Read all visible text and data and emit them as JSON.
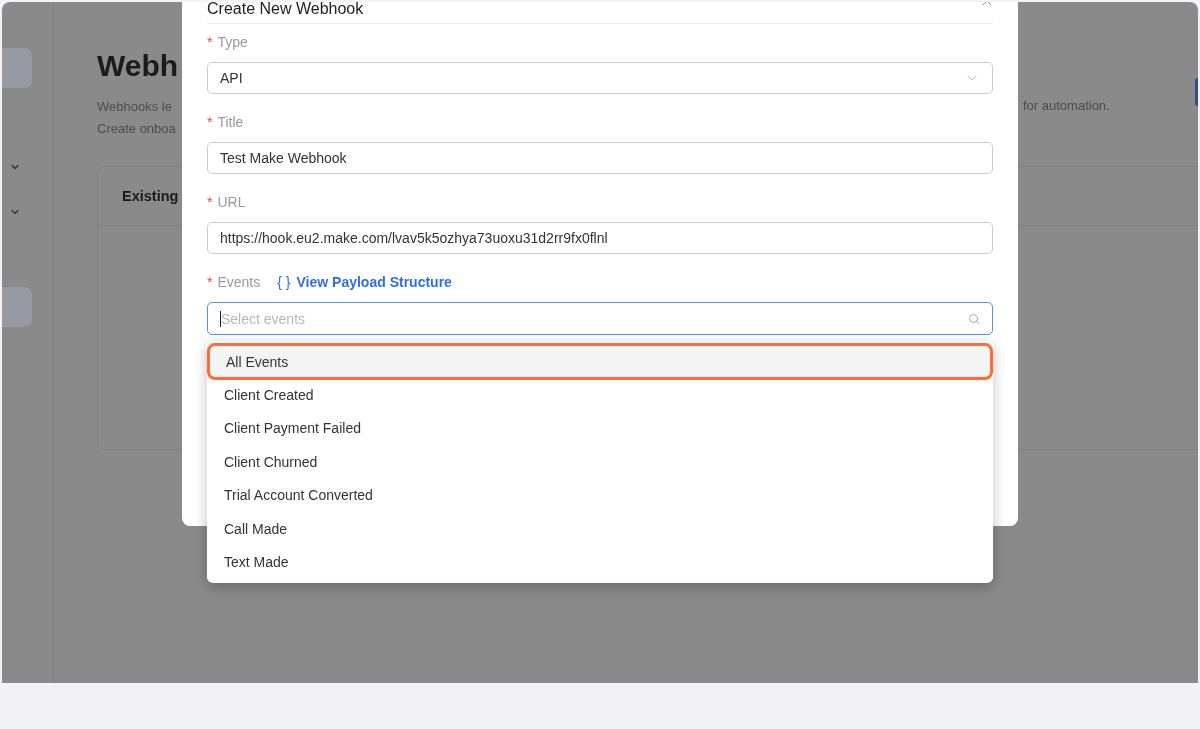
{
  "page": {
    "title": "Webh",
    "description": [
      "Webhooks le",
      "Create onboa"
    ],
    "description_end": "for automation.",
    "card_title": "Existing"
  },
  "modal": {
    "title": "Create New Webhook",
    "fields": [
      {
        "kind": "select",
        "label": "Type",
        "required_mark": "*",
        "value": "API"
      },
      {
        "kind": "text",
        "label": "Title",
        "required_mark": "*",
        "value": "Test Make Webhook"
      },
      {
        "kind": "text",
        "label": "URL",
        "required_mark": "*",
        "value": "https://hook.eu2.make.com/lvav5k5ozhya73uoxu31d2rr9fx0flnl"
      },
      {
        "kind": "search-select",
        "label": "Events",
        "required_mark": "*",
        "placeholder": "Select events",
        "focused": true,
        "link": "View Payload Structure",
        "link_icon": "{ }"
      }
    ],
    "dropdown": [
      {
        "label": "All Events",
        "selected": true
      },
      {
        "label": "Client Created",
        "selected": false
      },
      {
        "label": "Client Payment Failed",
        "selected": false
      },
      {
        "label": "Client Churned",
        "selected": false
      },
      {
        "label": "Trial Account Converted",
        "selected": false
      },
      {
        "label": "Call Made",
        "selected": false
      },
      {
        "label": "Text Made",
        "selected": false
      }
    ]
  }
}
